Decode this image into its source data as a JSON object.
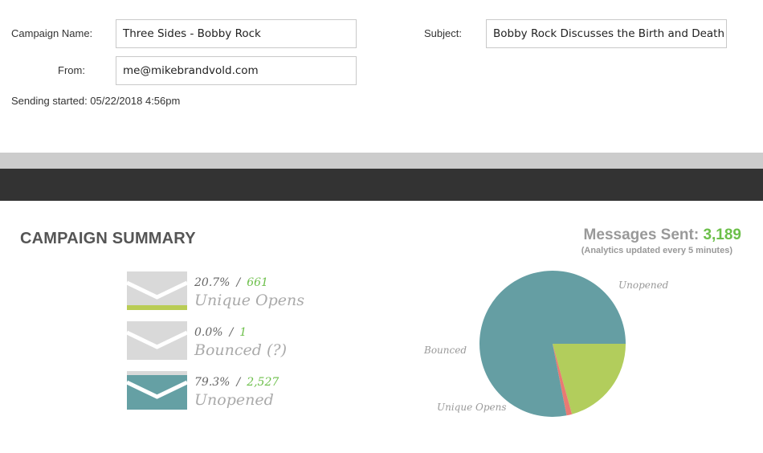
{
  "form": {
    "campaign_name_label": "Campaign Name:",
    "campaign_name_value": "Three Sides - Bobby Rock",
    "from_label": "From:",
    "from_value": "me@mikebrandvold.com",
    "subject_label": "Subject:",
    "subject_value": "Bobby Rock Discusses the Birth and Death of",
    "sending_started": "Sending started: 05/22/2018 4:56pm"
  },
  "summary": {
    "title": "CAMPAIGN SUMMARY",
    "messages_sent_label": "Messages Sent:",
    "messages_sent_value": "3,189",
    "analytics_note": "(Analytics updated every 5 minutes)",
    "stats": [
      {
        "percent": "20.7%",
        "count": "661",
        "label": "Unique Opens",
        "icon": "envelope-icon",
        "accent": "#b9cc55"
      },
      {
        "percent": "0.0%",
        "count": "1",
        "label": "Bounced",
        "help": "(?)",
        "icon": "envelope-icon",
        "accent": "#d9d9d9"
      },
      {
        "percent": "79.3%",
        "count": "2,527",
        "label": "Unopened",
        "icon": "envelope-icon",
        "accent": "#65a0a4"
      }
    ]
  },
  "chart_data": {
    "type": "pie",
    "slices": [
      {
        "label": "Unopened",
        "value": 2527,
        "color": "#659ea3"
      },
      {
        "label": "Unique Opens",
        "value": 661,
        "color": "#b2cd5c"
      },
      {
        "label": "Bounced",
        "value": 1,
        "color": "#e97a73"
      }
    ]
  }
}
